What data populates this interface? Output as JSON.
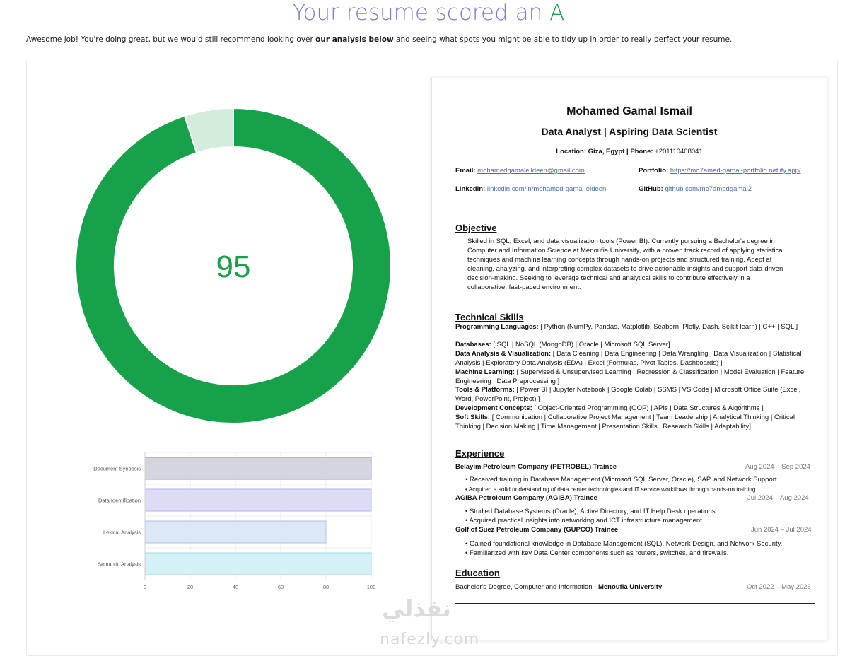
{
  "header": {
    "headline_prefix": "Your resume scored an ",
    "grade": "A",
    "intro_pre": "Awesome job! You're doing great, but we would still recommend looking over ",
    "intro_bold": "our analysis below",
    "intro_post": " and seeing what spots you might be able to tidy up in order to really perfect your resume."
  },
  "chart_data": [
    {
      "type": "pie",
      "variant": "donut",
      "score_label": "95",
      "values": [
        95,
        5
      ],
      "colors": [
        "#17a14a",
        "#d3ecdc"
      ]
    },
    {
      "type": "bar",
      "orientation": "horizontal",
      "categories": [
        "Document Synopsis",
        "Data Identification",
        "Lexical Analysis",
        "Semantic Analysis"
      ],
      "values": [
        100,
        100,
        80,
        100
      ],
      "fill_colors": [
        "#d4d5de",
        "#dcdcf7",
        "#dde8f7",
        "#d4f1f5"
      ],
      "stroke_colors": [
        "#9a9cab",
        "#b3b3ee",
        "#a9c1e6",
        "#9adbe3"
      ],
      "xlim": [
        0,
        100
      ],
      "xticks": [
        "0",
        "20",
        "40",
        "60",
        "80",
        "100"
      ],
      "grid": true
    }
  ],
  "resume": {
    "name": "Mohamed Gamal Ismail",
    "title": "Data Analyst | Aspiring Data Scientist",
    "location_label": "Location: Giza, Egypt | Phone:",
    "phone": " +201110408041",
    "email_label": "Email:",
    "email": "mohamedgamalelldeen@gmail.com",
    "portfolio_label": "Portfolio:",
    "portfolio": "https://mo7amed-gamal-portfolio.netlify.app/",
    "linkedin_label": "LinkedIn:",
    "linkedin": "linkedin.com/in/mohamed-gamal-eldeen",
    "github_label": "GitHub:",
    "github": "github.com/mo7amedgamal2",
    "objective_heading": "Objective",
    "objective_lines": [
      "Skilled in SQL, Excel, and data visualization tools (Power BI). Currently pursuing a Bachelor's degree in",
      "Computer and Information Science at Menoufia University, with a proven track record of applying statistical",
      "techniques and machine learning concepts through hands-on projects and structured training. Adept at",
      "cleaning, analyzing, and interpreting complex datasets to drive actionable insights and support data-driven",
      "decision-making. Seeking to leverage technical and analytical skills to contribute effectively in a",
      "collaborative, fast-paced environment."
    ],
    "skills_heading": "Technical Skills",
    "skills": [
      {
        "label": "Programming Languages:",
        "text": " [ Python (NumPy, Pandas, Matplotlib, Seaborn, Plotly, Dash, Scikit-learn) | C++ | SQL  ]"
      },
      {
        "label": "Databases:",
        "text": " [ SQL | NoSQL (MongoDB) | Oracle | Microsoft SQL Server]"
      },
      {
        "label": "Data Analysis & Visualization:",
        "text": " [ Data Cleaning | Data Engineering | Data Wrangling | Data Visualization | Statistical Analysis | Exploratory Data Analysis (EDA) | Excel (Formulas, Pivot Tables, Dashboards) ]"
      },
      {
        "label": "Machine Learning:",
        "text": " [ Supervised & Unsupervised Learning | Regression & Classification | Model Evaluation | Feature Engineering | Data Preprocessing ]"
      },
      {
        "label": "Tools & Platforms:",
        "text": " [ Power BI | Jupyter Notebook | Google Colab | SSMS | VS Code | Microsoft Office Suite (Excel, Word, PowerPoint, Project) ]"
      },
      {
        "label": "Development Concepts:",
        "text": " [ Object-Oriented Programming (OOP) | APIs | Data Structures & Algorithms ]"
      },
      {
        "label": "Soft Skills:",
        "text": " [ Communication | Collaborative Project Management | Team Leadership | Analytical Thinking | Critical Thinking | Decision Making | Time Management | Presentation Skills | Research Skills | Adaptability]"
      }
    ],
    "experience_heading": "Experience",
    "jobs": [
      {
        "title": "Belayim Petroleum Company (PETROBEL) Trainee",
        "date": "Aug 2024 – Sep 2024",
        "bullets": [
          "• Received training in Database Management (Microsoft SQL Server, Oracle), SAP, and Network Support.",
          "• Acquired a solid understanding of data center technologies and IT service workflows through hands-on training."
        ]
      },
      {
        "title": "AGIBA Petroleum Company (AGIBA) Trainee",
        "date": "Jul 2024 – Aug 2024",
        "bullets": [
          "• Studied Database Systems (Oracle), Active Directory, and IT Help Desk operations.",
          "• Acquired practical insights into networking and ICT infrastructure management"
        ]
      },
      {
        "title": "Golf of Suez Petroleum Company (GUPCO) Trainee",
        "date": "Jun 2024 – Jul 2024",
        "bullets": [
          "• Gained foundational knowledge in Database Management (SQL), Network Design, and Network Security.",
          "• Familiarized with key Data Center components such as routers, switches, and firewalls."
        ]
      }
    ],
    "education_heading": "Education",
    "education_degree": "Bachelor's Degree, Computer and Information - ",
    "education_school": "Menoufia University",
    "education_date": "Oct 2022 – May 2026"
  },
  "watermark": {
    "arabic": "نفذلي",
    "latin": "nafezly.com"
  }
}
